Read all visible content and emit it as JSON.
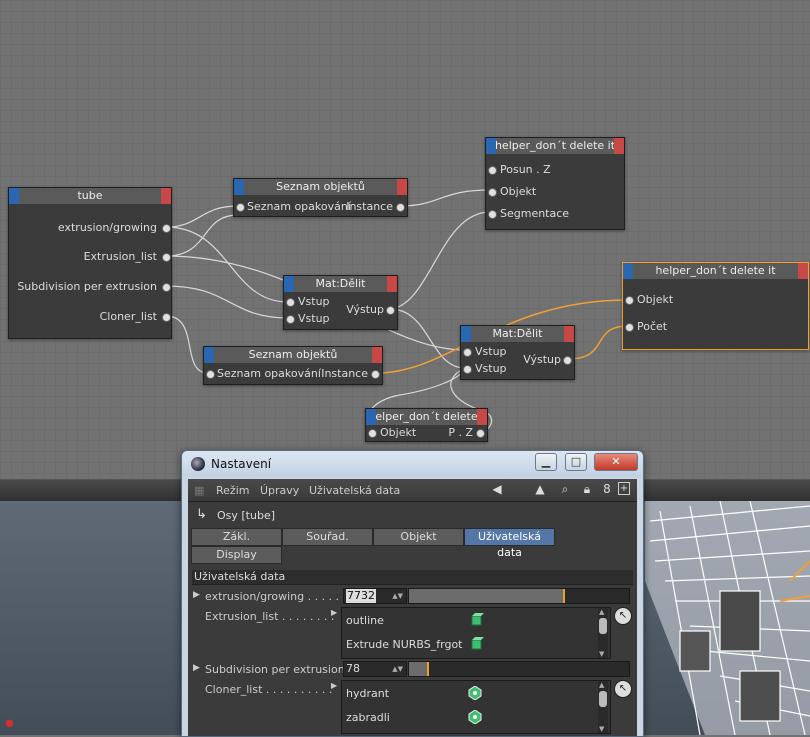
{
  "canvas": {
    "nodes": {
      "tube": {
        "title": "tube",
        "ports": [
          "extrusion/growing",
          "Extrusion_list",
          "Subdivision per extrusion",
          "Cloner_list"
        ]
      },
      "seznam1": {
        "title": "Seznam objektů",
        "in_label": "Seznam opakování",
        "out_label": "Instance"
      },
      "helper1": {
        "title": "helper_don´t delete it",
        "ports": [
          "Posun . Z",
          "Objekt",
          "Segmentace"
        ]
      },
      "mat1": {
        "title": "Mat:Dělit",
        "in1": "Vstup",
        "in2": "Vstup",
        "out_label": "Výstup"
      },
      "helper2": {
        "title": "helper_don´t delete it",
        "ports": [
          "Objekt",
          "Počet"
        ]
      },
      "mat2": {
        "title": "Mat:Dělit",
        "in1": "Vstup",
        "in2": "Vstup",
        "out_label": "Výstup"
      },
      "seznam2": {
        "title": "Seznam objektů",
        "in_label": "Seznam opakování",
        "out_label": "Instance"
      },
      "helper3": {
        "title": "elper_don´t delete",
        "in_label": "Objekt",
        "out_label": "P . Z"
      }
    }
  },
  "window": {
    "title": "Nastavení",
    "buttons": {
      "minimize": "▁",
      "maximize": "□",
      "close": "✕"
    },
    "menu": [
      "Režim",
      "Úpravy",
      "Uživatelská data"
    ],
    "toolbar_icons": [
      "arrow-left-icon",
      "arrow-up-icon",
      "search-icon",
      "lock-icon",
      "link-icon",
      "new-panel-icon"
    ],
    "object_name": "Osy [tube]",
    "tabs": [
      "Zákl.",
      "Souřad.",
      "Objekt",
      "Uživatelská data",
      "Display"
    ],
    "active_tab": "Uživatelská data",
    "section_title": "Uživatelská data",
    "params": {
      "extrusion": {
        "label": "extrusion/growing . . . . . .",
        "value": "7732",
        "slider_fraction": 0.7
      },
      "extrusion_list": {
        "label": "Extrusion_list . . . . . . . .",
        "items": [
          "outline",
          "Extrude NURBS_frgot"
        ]
      },
      "subdivision": {
        "label": "Subdivision per extrusion",
        "value": "78",
        "slider_fraction": 0.08
      },
      "cloner_list": {
        "label": "Cloner_list . . . . . . . . . .",
        "items": [
          "hydrant",
          "zabradli"
        ]
      }
    }
  },
  "colors": {
    "canvas_bg": "#727272",
    "node_bg": "#3b3b3b",
    "node_header": "#5a5a5a",
    "port_blue": "#2b66b0",
    "port_red": "#c84848",
    "wire_white": "#d8d8d8",
    "wire_orange": "#f0a030",
    "tab_active": "#5577a7"
  }
}
